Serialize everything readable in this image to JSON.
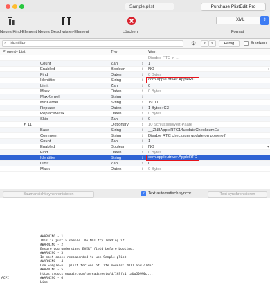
{
  "window": {
    "file_title": "Sample.plist",
    "purchase_button": "Purchase PlistEdit Pro"
  },
  "toolbar": {
    "new_child": "Neues Kind-Element",
    "new_sibling": "Neues Geschwister-Element",
    "delete": "Löschen",
    "format_value": "XML",
    "format_label": "Format"
  },
  "search": {
    "placeholder": "Identifier",
    "prev": "<",
    "next": ">",
    "done": "Fertig",
    "replace": "Ersetzen"
  },
  "columns": {
    "key": "Property List",
    "type": "Typ",
    "value": "Wert"
  },
  "rows": [
    {
      "key": "",
      "type": "",
      "value": "Disable FTC in …"
    },
    {
      "key": "Count",
      "type": "Zahl",
      "value": "1"
    },
    {
      "key": "Enabled",
      "type": "Boolean",
      "value": "NO"
    },
    {
      "key": "Find",
      "type": "Daten",
      "value": "0 Bytes"
    },
    {
      "key": "Identifier",
      "type": "String",
      "value": "com.apple.driver.AppleRTC"
    },
    {
      "key": "Limit",
      "type": "Zahl",
      "value": "0"
    },
    {
      "key": "Mask",
      "type": "Daten",
      "value": "0 Bytes"
    },
    {
      "key": "MaxKernel",
      "type": "String",
      "value": ""
    },
    {
      "key": "MinKernel",
      "type": "String",
      "value": "19.0.0"
    },
    {
      "key": "Replace",
      "type": "Daten",
      "value": "1 Bytes: C3"
    },
    {
      "key": "ReplaceMask",
      "type": "Daten",
      "value": "0 Bytes"
    },
    {
      "key": "Skip",
      "type": "Zahl",
      "value": "0"
    },
    {
      "key": "11",
      "type": "Dictionary",
      "value": "10 Schlüssel/Wert-Paare"
    },
    {
      "key": "Base",
      "type": "String",
      "value": "__ZN8AppleRTC14updateChecksumEv"
    },
    {
      "key": "Comment",
      "type": "String",
      "value": "Disable RTC checksum update on poweroff"
    },
    {
      "key": "Count",
      "type": "Zahl",
      "value": "1"
    },
    {
      "key": "Enabled",
      "type": "Boolean",
      "value": "NO"
    },
    {
      "key": "Find",
      "type": "Daten",
      "value": "0 Bytes"
    },
    {
      "key": "Identifier",
      "type": "String",
      "value": "com.apple.driver.AppleRTC"
    },
    {
      "key": "Limit",
      "type": "Zahl",
      "value": "0"
    },
    {
      "key": "Mask",
      "type": "Daten",
      "value": "0 Bytes"
    }
  ],
  "bottom": {
    "left_button": "Baumansicht synchronisieren",
    "sync_label": "Text automatisch synchr.",
    "right_button": "Text synchronisieren"
  },
  "text_lines": [
    "#WARNING - 1",
    "  This is just a sample. Do NOT try loading it.",
    "#WARNING - 2",
    "  Ensure you understand EVERY field before booting.",
    "#WARNING - 3",
    "  In most cases recommended to use Sample.plist",
    "#WARNING - 4",
    "  Use SampleFull.plist for end of life models: 2011 and older.",
    "#WARNING - 5",
    "  https://docs.google.com/spreadsheets/d/1HSfs1_taUuG09M0p...",
    "#WARNING - 6",
    "  Line"
  ],
  "text_gutter": "ACPI"
}
